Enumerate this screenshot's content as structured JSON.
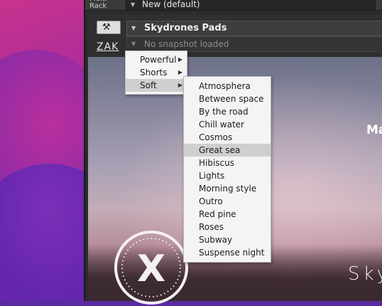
{
  "rack": {
    "label": "Multi Rack",
    "dropdown_value": "New (default)"
  },
  "plugin": {
    "logo": "ZAK",
    "instrument_name": "Skydrones Pads",
    "snapshot_placeholder": "No snapshot loaded",
    "partial_text_right": "Ma",
    "product_partial_title": "Sky",
    "x_logo_letter": "X"
  },
  "category_menu": {
    "items": [
      {
        "label": "Powerful",
        "has_submenu": true,
        "selected": false
      },
      {
        "label": "Shorts",
        "has_submenu": true,
        "selected": false
      },
      {
        "label": "Soft",
        "has_submenu": true,
        "selected": true
      }
    ]
  },
  "preset_menu": {
    "items": [
      "Atmosphera",
      "Between space",
      "By the road",
      "Chill water",
      "Cosmos",
      "Great sea",
      "Hibiscus",
      "Lights",
      "Morning style",
      "Outro",
      "Red pine",
      "Roses",
      "Subway",
      "Suspense night"
    ],
    "highlighted": "Great sea"
  },
  "icons": {
    "dropdown_arrow": "triangle-down-icon",
    "submenu_arrow": "triangle-right-icon",
    "settings": "wrench-icon"
  },
  "colors": {
    "menu_bg": "#f4f4f4",
    "menu_highlight": "#cfcfcf",
    "host_bg": "#2b2b2b"
  }
}
